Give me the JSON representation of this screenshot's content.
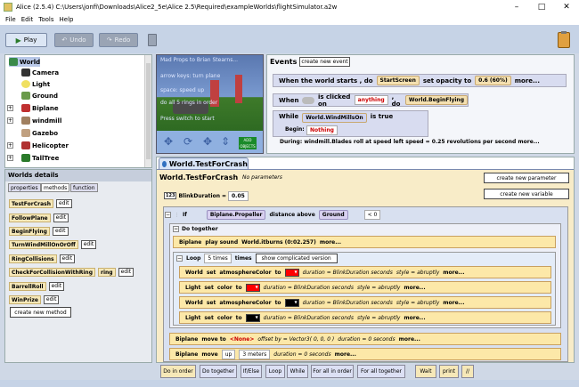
{
  "window": {
    "title": "Alice (2.5.4) C:\\Users\\jonfi\\Downloads\\Alice2_5e\\Alice 2.5\\Required\\exampleWorlds\\flightSimulator.a2w",
    "minimize": "–",
    "maximize": "□",
    "close": "✕"
  },
  "menu": [
    "File",
    "Edit",
    "Tools",
    "Help"
  ],
  "toolbar": {
    "play": "Play",
    "undo": "Undo",
    "redo": "Redo"
  },
  "object_tree": [
    "World",
    "Camera",
    "Light",
    "Ground",
    "Biplane",
    "windmill",
    "Gazebo",
    "Helicopter",
    "TallTree"
  ],
  "world_view": {
    "lines": [
      "Mad Props to Brian Stearns...",
      "arrow keys: turn plane",
      "space: speed up",
      "do all 5 rings in order",
      "Press switch to start"
    ],
    "add_objects": "ADD OBJECTS"
  },
  "events": {
    "title": "Events",
    "create_button": "create new event",
    "row1": {
      "when": "When the world starts , do",
      "target": "StartScreen",
      "action": "set opacity to",
      "value": "0.6 (60%)",
      "more": "more..."
    },
    "row2": {
      "when": "When",
      "is_clicked": "is clicked on",
      "what": "anything",
      "do": ", do",
      "method": "World.BeginFlying"
    },
    "row3": {
      "while": "While",
      "cond": "World.WindMillsOn",
      "istrue": "is true",
      "begin": "Begin:",
      "nothing": "Nothing"
    },
    "row4": "During: windmill.Blades   roll at speed  left   speed = 0.25 revolutions per second   more..."
  },
  "details": {
    "title": "Worlds details",
    "tabs": [
      "properties",
      "methods",
      "function"
    ],
    "methods": [
      "TestForCrash",
      "FollowPlane",
      "BeginFlying",
      "TurnWindMillOnOrOff",
      "RingCollisions",
      "CheckForCollisionWithRing",
      "BarrellRoll",
      "WinPrize"
    ],
    "edit": "edit",
    "ring_param": "ring",
    "create_method": "create new method"
  },
  "editor": {
    "tab": "World.TestForCrash",
    "method_name": "World.TestForCrash",
    "params": "No parameters",
    "create_param": "create new parameter",
    "create_var": "create new variable",
    "var_type": "123",
    "var_name": "BlinkDuration",
    "var_eq": "=",
    "var_value": "0.05",
    "if_kw": "If",
    "if_obj": "Biplane.Propeller",
    "if_fn": "distance above",
    "if_arg": "Ground",
    "if_op": "< 0",
    "do_together": "Do together",
    "sound": {
      "obj": "Biplane",
      "action": "play sound",
      "snd": "World.itburns (0:02.257)",
      "more": "more..."
    },
    "loop": {
      "kw": "Loop",
      "times": "5 times",
      "times_word": "times",
      "complicated": "show complicated version"
    },
    "inner": [
      {
        "obj": "World",
        "action": "set",
        "prop": "atmosphereColor",
        "to": "to",
        "color": "#ff0000",
        "dur": "duration = BlinkDuration seconds",
        "style": "style = abruptly",
        "more": "more..."
      },
      {
        "obj": "Light",
        "action": "set",
        "prop": "color",
        "to": "to",
        "color": "#ff0000",
        "dur": "duration = BlinkDuration seconds",
        "style": "style = abruptly",
        "more": "more..."
      },
      {
        "obj": "World",
        "action": "set",
        "prop": "atmosphereColor",
        "to": "to",
        "color": "#000000",
        "dur": "duration = BlinkDuration seconds",
        "style": "style = abruptly",
        "more": "more..."
      },
      {
        "obj": "Light",
        "action": "set",
        "prop": "color",
        "to": "to",
        "color": "#000000",
        "dur": "duration = BlinkDuration seconds",
        "style": "style = abruptly",
        "more": "more..."
      }
    ],
    "move_to": {
      "obj": "Biplane",
      "action": "move to",
      "target": "<None>",
      "offset": "offset by = Vector3( 0, 0, 0 )",
      "dur": "duration = 0 seconds",
      "more": "more..."
    },
    "move_up": {
      "obj": "Biplane",
      "action": "move",
      "dir": "up",
      "dist": "3 meters",
      "dur": "duration = 0 seconds",
      "more": "more..."
    }
  },
  "controls": [
    "Do in order",
    "Do together",
    "If/Else",
    "Loop",
    "While",
    "For all in order",
    "For all together",
    "Wait",
    "print",
    "//"
  ]
}
